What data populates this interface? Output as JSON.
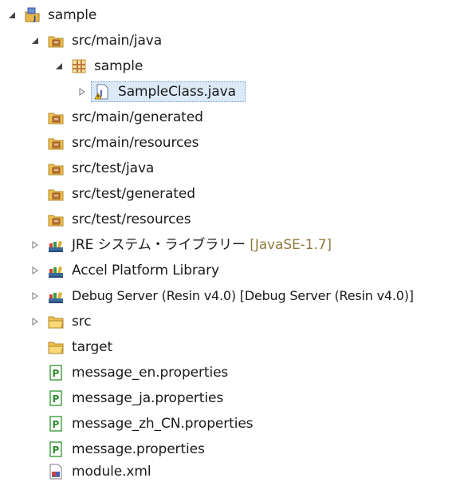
{
  "tree": {
    "project": {
      "label": "sample",
      "icon": "java-project-icon",
      "toggle": "expanded"
    },
    "src_main_java": {
      "label": "src/main/java",
      "icon": "source-folder-icon",
      "toggle": "expanded"
    },
    "package_sample": {
      "label": "sample",
      "icon": "package-icon",
      "toggle": "expanded"
    },
    "sample_class": {
      "label": "SampleClass.java",
      "icon": "java-file-icon",
      "toggle": "collapsed",
      "selected": true
    },
    "src_main_generated": {
      "label": "src/main/generated",
      "icon": "source-folder-icon"
    },
    "src_main_resources": {
      "label": "src/main/resources",
      "icon": "source-folder-icon"
    },
    "src_test_java": {
      "label": "src/test/java",
      "icon": "source-folder-icon"
    },
    "src_test_generated": {
      "label": "src/test/generated",
      "icon": "source-folder-icon"
    },
    "src_test_resources": {
      "label": "src/test/resources",
      "icon": "source-folder-icon"
    },
    "jre_library": {
      "label": "JRE システム・ライブラリー",
      "decoration": "[JavaSE-1.7]",
      "icon": "library-icon",
      "toggle": "collapsed"
    },
    "accel_library": {
      "label": "Accel Platform Library",
      "icon": "library-icon",
      "toggle": "collapsed"
    },
    "debug_server": {
      "label": "Debug Server (Resin v4.0) [Debug Server (Resin v4.0)]",
      "icon": "library-icon",
      "toggle": "collapsed"
    },
    "src_folder": {
      "label": "src",
      "icon": "folder-icon",
      "toggle": "collapsed"
    },
    "target_folder": {
      "label": "target",
      "icon": "folder-icon"
    },
    "msg_en": {
      "label": "message_en.properties",
      "icon": "properties-file-icon"
    },
    "msg_ja": {
      "label": "message_ja.properties",
      "icon": "properties-file-icon"
    },
    "msg_zh": {
      "label": "message_zh_CN.properties",
      "icon": "properties-file-icon"
    },
    "msg_default": {
      "label": "message.properties",
      "icon": "properties-file-icon"
    },
    "module_xml": {
      "label": "module.xml",
      "icon": "xml-file-icon"
    }
  },
  "colors": {
    "selection_bg": "#dbe9f8",
    "decoration_text": "#8e7a3e",
    "properties_icon": "#3c9a3c",
    "folder": "#f0c050"
  }
}
